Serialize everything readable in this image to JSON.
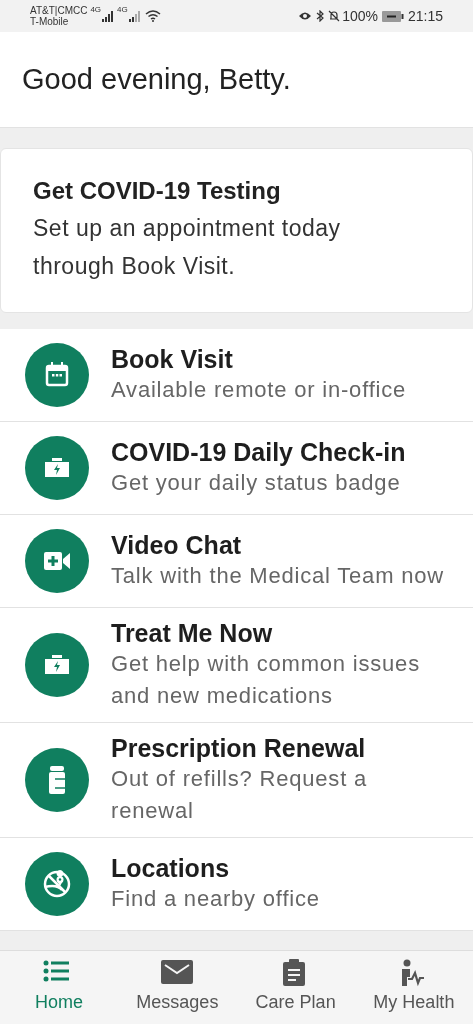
{
  "status_bar": {
    "carrier_1": "AT&T|CMCC",
    "carrier_2": "T-Mobile",
    "network_1": "4G",
    "network_2": "4G",
    "battery": "100%",
    "time": "21:15"
  },
  "greeting": "Good evening, Betty.",
  "banner": {
    "title": "Get COVID-19 Testing",
    "body": "Set up an appointment today through Book Visit."
  },
  "items": [
    {
      "title": "Book Visit",
      "subtitle": "Available remote or in-office"
    },
    {
      "title": "COVID-19 Daily Check-in",
      "subtitle": "Get your daily status badge"
    },
    {
      "title": "Video Chat",
      "subtitle": "Talk with the Medical Team now"
    },
    {
      "title": "Treat Me Now",
      "subtitle": "Get help with common issues and new medications"
    },
    {
      "title": "Prescription Renewal",
      "subtitle": "Out of refills? Request a renewal"
    },
    {
      "title": "Locations",
      "subtitle": "Find a nearby office"
    }
  ],
  "nav": [
    {
      "label": "Home",
      "selected": true
    },
    {
      "label": "Messages",
      "selected": false
    },
    {
      "label": "Care Plan",
      "selected": false
    },
    {
      "label": "My Health",
      "selected": false
    }
  ]
}
